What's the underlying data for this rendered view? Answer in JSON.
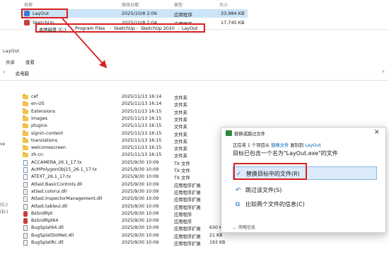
{
  "top": {
    "header": {
      "name": "名称",
      "date": "修改日期",
      "type": "类型",
      "size": "大小"
    },
    "rows": [
      {
        "name": "LayOut",
        "date": "2025/10/8 2:06",
        "type": "应用程序",
        "size": "33,984 KB"
      },
      {
        "name": "SketchUp",
        "date": "2025/10/8 2:04",
        "type": "应用程序",
        "size": "17,745 KB"
      }
    ]
  },
  "explorer": {
    "title": "LayOut",
    "tabs": [
      "共享",
      "查看"
    ],
    "breadcrumb": [
      "此电脑",
      "本地磁盘 (C:)",
      "Program Files",
      "SketchUp",
      "SketchUp 2020",
      "LayOut"
    ],
    "left_nav": [
      "ve",
      "(C:)",
      "(D:)"
    ],
    "files": [
      {
        "name": "cef",
        "date": "2025/11/13 16:14",
        "type": "文件夹",
        "icon": "folder",
        "size": ""
      },
      {
        "name": "en-US",
        "date": "2025/11/13 16:14",
        "type": "文件夹",
        "icon": "folder",
        "size": ""
      },
      {
        "name": "Extensions",
        "date": "2025/11/13 16:15",
        "type": "文件夹",
        "icon": "folder",
        "size": ""
      },
      {
        "name": "Images",
        "date": "2025/11/13 16:15",
        "type": "文件夹",
        "icon": "folder",
        "size": ""
      },
      {
        "name": "plugins",
        "date": "2025/11/13 16:15",
        "type": "文件夹",
        "icon": "folder",
        "size": ""
      },
      {
        "name": "signin-content",
        "date": "2025/11/13 16:15",
        "type": "文件夹",
        "icon": "folder",
        "size": ""
      },
      {
        "name": "translations",
        "date": "2025/11/13 16:15",
        "type": "文件夹",
        "icon": "folder",
        "size": ""
      },
      {
        "name": "welcomescreen",
        "date": "2025/11/13 16:15",
        "type": "文件夹",
        "icon": "folder",
        "size": ""
      },
      {
        "name": "zh-cn",
        "date": "2025/11/13 16:15",
        "type": "文件夹",
        "icon": "folder",
        "size": ""
      },
      {
        "name": "ACCAMERA_26.1_17.tx",
        "date": "2025/9/30 10:09",
        "type": "TX 文件",
        "icon": "tx",
        "size": ""
      },
      {
        "name": "AcMPolygonObj15_26.1_17.tx",
        "date": "2025/9/30 10:09",
        "type": "TX 文件",
        "icon": "tx",
        "size": ""
      },
      {
        "name": "ATEXT_26.1_17.tx",
        "date": "2025/9/30 10:09",
        "type": "TX 文件",
        "icon": "tx",
        "size": ""
      },
      {
        "name": "Atlast.BasicControls.dll",
        "date": "2025/9/30 10:09",
        "type": "应用程序扩展",
        "icon": "dll",
        "size": ""
      },
      {
        "name": "atlast.colorui.dll",
        "date": "2025/9/30 10:09",
        "type": "应用程序扩展",
        "icon": "dll",
        "size": ""
      },
      {
        "name": "Atlast.InspectorManagement.dll",
        "date": "2025/9/30 10:09",
        "type": "应用程序扩展",
        "icon": "dll",
        "size": ""
      },
      {
        "name": "Atlast.tableui.dll",
        "date": "2025/9/30 10:09",
        "type": "应用程序扩展",
        "icon": "dll",
        "size": ""
      },
      {
        "name": "BsSndRpt",
        "date": "2025/9/30 10:09",
        "type": "应用程序",
        "icon": "red",
        "size": ""
      },
      {
        "name": "BsSndRpt64",
        "date": "2025/9/30 10:09",
        "type": "应用程序",
        "icon": "red",
        "size": ""
      },
      {
        "name": "BugSplat64.dll",
        "date": "2025/9/30 10:09",
        "type": "应用程序扩展",
        "icon": "dll",
        "size": "630 KB"
      },
      {
        "name": "BugSplatDotNet.dll",
        "date": "2025/9/30 10:09",
        "type": "应用程序扩展",
        "icon": "dll",
        "size": "21 KB"
      },
      {
        "name": "BugSplatRc.dll",
        "date": "2025/9/30 10:09",
        "type": "应用程序扩展",
        "icon": "dll",
        "size": "193 KB"
      }
    ]
  },
  "dialog": {
    "title": "替换或跳过文件",
    "info": {
      "p1": "正在将 1 个项目从",
      "src": "替换文件",
      "p2": "复制到",
      "dst": "LayOut"
    },
    "heading": "目标已包含一个名为\"LayOut.exe\"的文件",
    "options": [
      "替换目标中的文件(R)",
      "跳过该文件(S)",
      "比较两个文件的信息(C)"
    ],
    "footer": "简略信息"
  },
  "colors": {
    "highlight_red": "#d92020",
    "accent_blue": "#0063b1",
    "selection": "#cce4f7"
  }
}
